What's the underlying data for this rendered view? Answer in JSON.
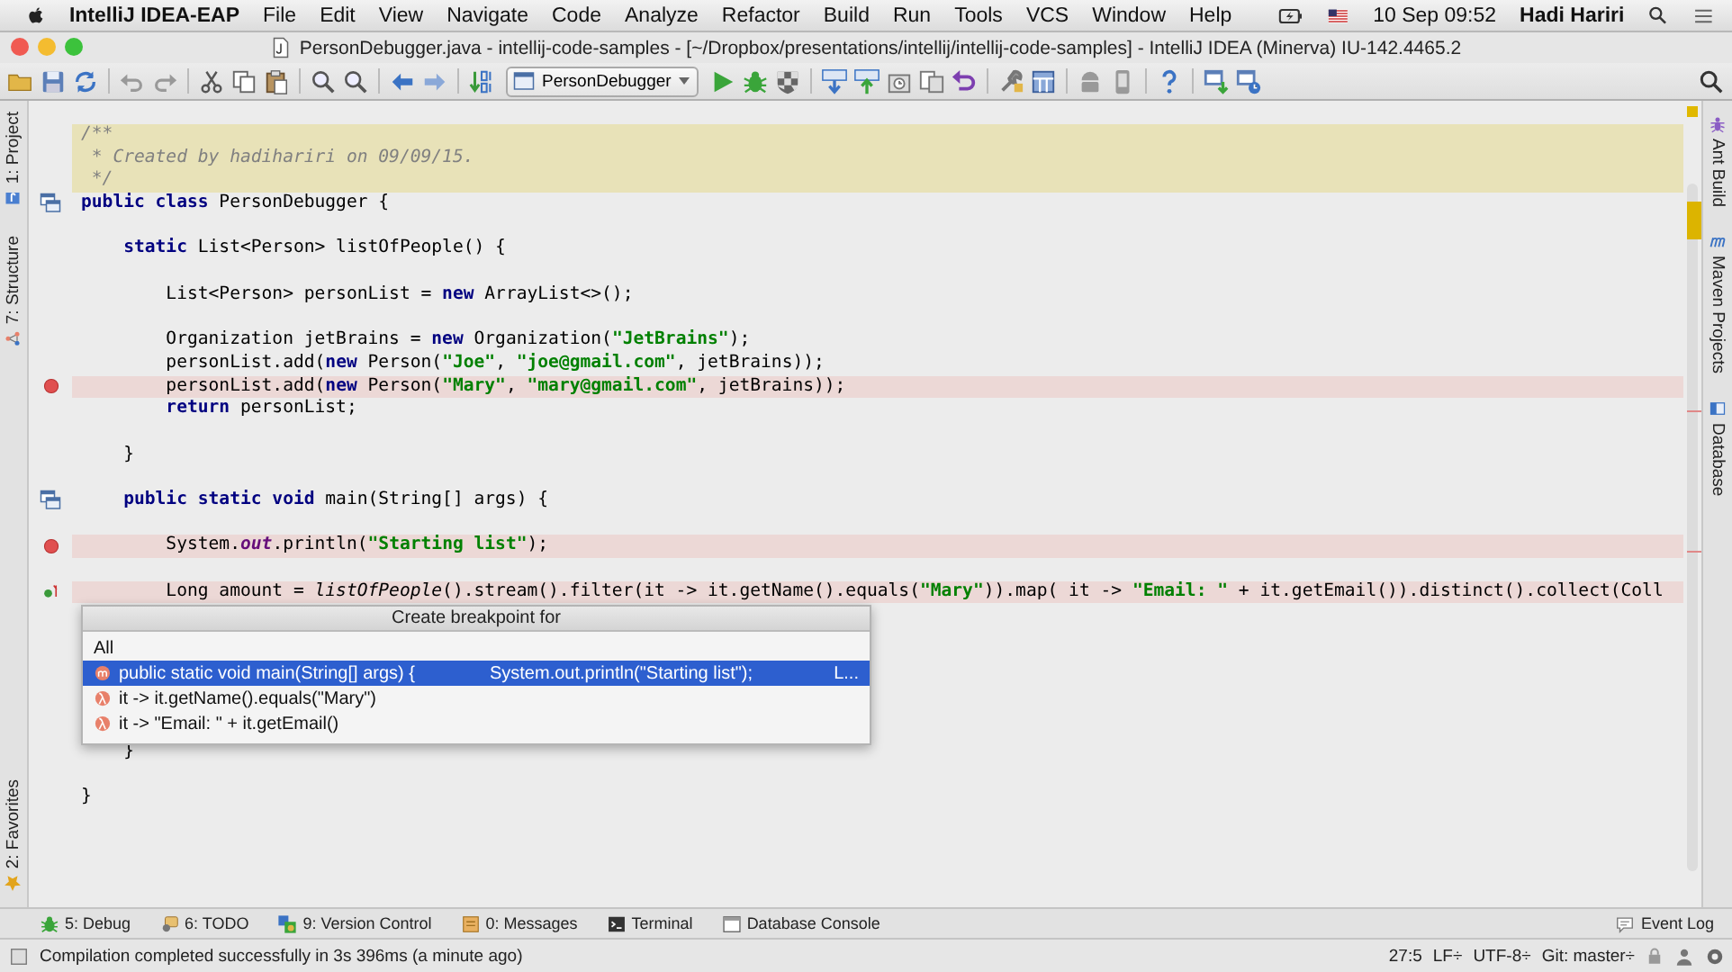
{
  "menu_bar": {
    "app_name": "IntelliJ IDEA-EAP",
    "items": [
      "File",
      "Edit",
      "View",
      "Navigate",
      "Code",
      "Analyze",
      "Refactor",
      "Build",
      "Run",
      "Tools",
      "VCS",
      "Window",
      "Help"
    ],
    "clock": "10 Sep 09:52",
    "user": "Hadi Hariri"
  },
  "window": {
    "title": "PersonDebugger.java - intellij-code-samples - [~/Dropbox/presentations/intellij/intellij-code-samples] - IntelliJ IDEA (Minerva) IU-142.4465.2"
  },
  "toolbar": {
    "run_configuration": "PersonDebugger"
  },
  "left_tool_tabs": {
    "top": [
      {
        "label": "1: Project"
      },
      {
        "label": "7: Structure"
      }
    ],
    "bottom": [
      {
        "label": "2: Favorites"
      }
    ]
  },
  "right_tool_tabs": [
    {
      "label": "Ant Build"
    },
    {
      "label": "Maven Projects"
    },
    {
      "label": "Database"
    }
  ],
  "editor": {
    "lines": [
      {
        "kind": "doc",
        "highlighted": false,
        "tokens": [
          {
            "kind": "comment",
            "text": "/**"
          }
        ]
      },
      {
        "kind": "doc",
        "highlighted": false,
        "tokens": [
          {
            "kind": "comment",
            "text": " * Created by hadihariri on 09/09/15."
          }
        ]
      },
      {
        "kind": "doc",
        "highlighted": false,
        "tokens": [
          {
            "kind": "comment",
            "text": " */"
          }
        ]
      },
      {
        "kind": "code",
        "highlighted": false,
        "gutter": {
          "kind": "class-marker"
        },
        "tokens": [
          {
            "kind": "keyword",
            "text": "public class"
          },
          {
            "kind": "plain",
            "text": " PersonDebugger {"
          }
        ]
      },
      {
        "kind": "blank"
      },
      {
        "kind": "code",
        "highlighted": false,
        "tokens": [
          {
            "kind": "keyword",
            "text": "    static"
          },
          {
            "kind": "plain",
            "text": " List<Person> listOfPeople() {"
          }
        ]
      },
      {
        "kind": "blank"
      },
      {
        "kind": "code",
        "highlighted": false,
        "tokens": [
          {
            "kind": "plain",
            "text": "        List<Person> personList = "
          },
          {
            "kind": "keyword",
            "text": "new"
          },
          {
            "kind": "plain",
            "text": " ArrayList<>();"
          }
        ]
      },
      {
        "kind": "blank"
      },
      {
        "kind": "code",
        "highlighted": false,
        "tokens": [
          {
            "kind": "plain",
            "text": "        Organization jetBrains = "
          },
          {
            "kind": "keyword",
            "text": "new"
          },
          {
            "kind": "plain",
            "text": " Organization("
          },
          {
            "kind": "string",
            "text": "\"JetBrains\""
          },
          {
            "kind": "plain",
            "text": ");"
          }
        ]
      },
      {
        "kind": "code",
        "highlighted": false,
        "tokens": [
          {
            "kind": "plain",
            "text": "        personList.add("
          },
          {
            "kind": "keyword",
            "text": "new"
          },
          {
            "kind": "plain",
            "text": " Person("
          },
          {
            "kind": "string",
            "text": "\"Joe\""
          },
          {
            "kind": "plain",
            "text": ", "
          },
          {
            "kind": "string",
            "text": "\"joe@gmail.com\""
          },
          {
            "kind": "plain",
            "text": ", jetBrains));"
          }
        ]
      },
      {
        "kind": "code",
        "highlighted": true,
        "gutter": {
          "kind": "breakpoint"
        },
        "tokens": [
          {
            "kind": "plain",
            "text": "        personList.add("
          },
          {
            "kind": "keyword",
            "text": "new"
          },
          {
            "kind": "plain",
            "text": " Person("
          },
          {
            "kind": "string",
            "text": "\"Mary\""
          },
          {
            "kind": "plain",
            "text": ", "
          },
          {
            "kind": "string",
            "text": "\"mary@gmail.com\""
          },
          {
            "kind": "plain",
            "text": ", jetBrains));"
          }
        ]
      },
      {
        "kind": "code",
        "highlighted": false,
        "tokens": [
          {
            "kind": "keyword",
            "text": "        return"
          },
          {
            "kind": "plain",
            "text": " personList;"
          }
        ]
      },
      {
        "kind": "blank"
      },
      {
        "kind": "code",
        "highlighted": false,
        "tokens": [
          {
            "kind": "plain",
            "text": "    }"
          }
        ]
      },
      {
        "kind": "blank"
      },
      {
        "kind": "code",
        "highlighted": false,
        "gutter": {
          "kind": "class-marker"
        },
        "tokens": [
          {
            "kind": "keyword",
            "text": "    public static void"
          },
          {
            "kind": "plain",
            "text": " main(String[] args) {"
          }
        ]
      },
      {
        "kind": "blank"
      },
      {
        "kind": "code",
        "highlighted": true,
        "gutter": {
          "kind": "breakpoint"
        },
        "tokens": [
          {
            "kind": "plain",
            "text": "        System."
          },
          {
            "kind": "field",
            "text": "out"
          },
          {
            "kind": "plain",
            "text": ".println("
          },
          {
            "kind": "string",
            "text": "\"Starting list\""
          },
          {
            "kind": "plain",
            "text": ");"
          }
        ]
      },
      {
        "kind": "blank"
      },
      {
        "kind": "code",
        "highlighted": true,
        "gutter": {
          "kind": "pending-breakpoint"
        },
        "tokens": [
          {
            "kind": "plain",
            "text": "        Long amount = "
          },
          {
            "kind": "italic",
            "text": "listOfPeople"
          },
          {
            "kind": "plain",
            "text": "().stream().filter(it -> it.getName().equals("
          },
          {
            "kind": "string",
            "text": "\"Mary\""
          },
          {
            "kind": "plain",
            "text": ")).map( it -> "
          },
          {
            "kind": "string",
            "text": "\"Email: \""
          },
          {
            "kind": "plain",
            "text": " + it.getEmail()).distinct().collect(Coll"
          }
        ]
      },
      {
        "kind": "blank"
      },
      {
        "kind": "blank"
      },
      {
        "kind": "blank"
      },
      {
        "kind": "blank"
      },
      {
        "kind": "blank"
      },
      {
        "kind": "blank"
      },
      {
        "kind": "code",
        "highlighted": false,
        "tokens": [
          {
            "kind": "plain",
            "text": "    }"
          }
        ]
      },
      {
        "kind": "blank"
      },
      {
        "kind": "code",
        "highlighted": false,
        "tokens": [
          {
            "kind": "plain",
            "text": "}"
          }
        ]
      }
    ],
    "popup": {
      "title": "Create breakpoint for",
      "items": [
        {
          "kind": "all",
          "label": "All",
          "selected": false
        },
        {
          "kind": "method",
          "label": "public static void main(String[] args) {",
          "context": "System.out.println(\"Starting list\");",
          "line": "L...",
          "selected": true
        },
        {
          "kind": "lambda",
          "label": "it -> it.getName().equals(\"Mary\")",
          "selected": false
        },
        {
          "kind": "lambda",
          "label": "it -> \"Email: \" + it.getEmail()",
          "selected": false
        }
      ]
    }
  },
  "tool_tabs": {
    "left": [
      {
        "label": "5: Debug"
      },
      {
        "label": "6: TODO"
      },
      {
        "label": "9: Version Control"
      },
      {
        "label": "0: Messages"
      },
      {
        "label": "Terminal"
      },
      {
        "label": "Database Console"
      }
    ],
    "right": [
      {
        "label": "Event Log"
      }
    ]
  },
  "status_bar": {
    "message": "Compilation completed successfully in 3s 396ms (a minute ago)",
    "position": "27:5",
    "line_separator": "LF÷",
    "encoding": "UTF-8÷",
    "vcs_branch": "Git: master÷"
  }
}
